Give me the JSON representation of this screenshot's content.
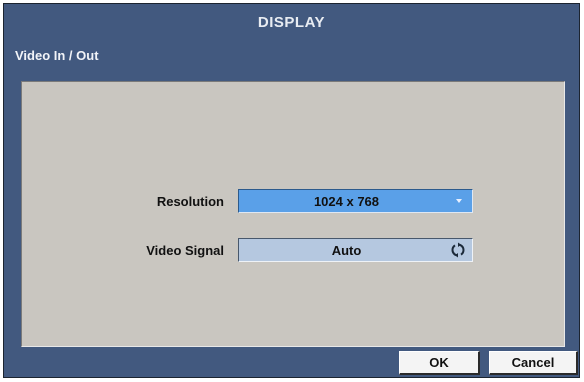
{
  "dialog": {
    "title": "DISPLAY",
    "section": "Video In / Out"
  },
  "fields": {
    "resolution": {
      "label": "Resolution",
      "value": "1024 x 768",
      "control": "dropdown",
      "icon": "chevron-down-icon"
    },
    "video_signal": {
      "label": "Video Signal",
      "value": "Auto",
      "control": "cycle-selector",
      "icon": "cycle-icon"
    }
  },
  "buttons": {
    "ok": "OK",
    "cancel": "Cancel"
  },
  "colors": {
    "dialog_bg": "#42597f",
    "panel_bg": "#c9c6c0",
    "selected_field": "#5aa0e8",
    "field_bg": "#b5c8e0",
    "button_bg": "#f4f4f4"
  }
}
